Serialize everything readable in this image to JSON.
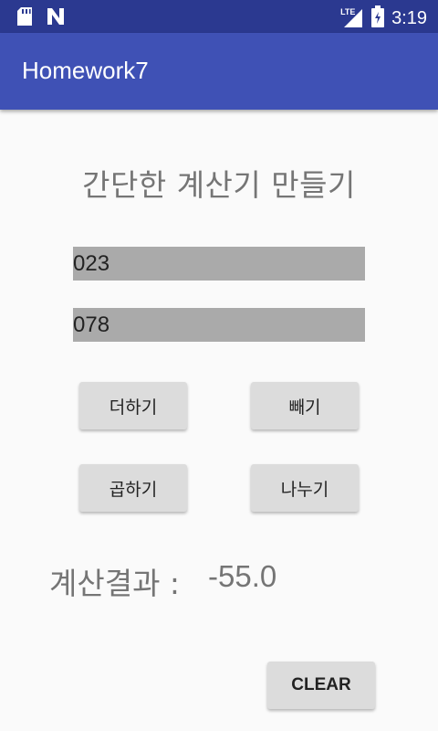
{
  "status_bar": {
    "time": "3:19",
    "network_label": "LTE",
    "icons": [
      "sd-card-icon",
      "n-notification-icon",
      "signal-icon",
      "battery-icon"
    ]
  },
  "app_bar": {
    "title": "Homework7",
    "color": "#3f51b5",
    "status_color": "#2b3990"
  },
  "main": {
    "heading": "간단한 계산기 만들기",
    "input1": "023",
    "input2": "078",
    "buttons": {
      "add": "더하기",
      "subtract": "빼기",
      "multiply": "곱하기",
      "divide": "나누기",
      "clear": "CLEAR"
    },
    "result_label": "계산결과 :",
    "result_value": "-55.0"
  }
}
